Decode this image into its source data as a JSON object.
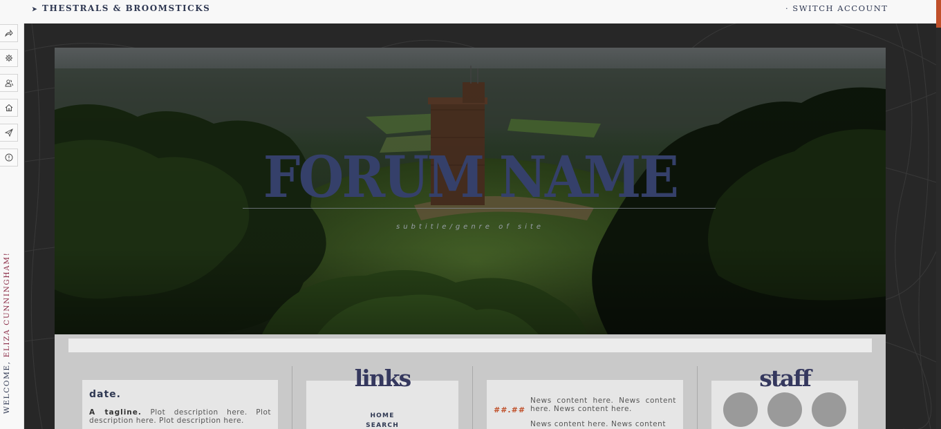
{
  "topbar": {
    "site_name": "THESTRALS & BROOMSTICKS",
    "switch_account": "· SWITCH ACCOUNT"
  },
  "sidebar": {
    "buttons": [
      {
        "icon": "share-icon"
      },
      {
        "icon": "gear-icon"
      },
      {
        "icon": "users-icon"
      },
      {
        "icon": "home-icon"
      },
      {
        "icon": "send-icon"
      },
      {
        "icon": "info-icon"
      }
    ],
    "welcome_prefix": "WELCOME, ",
    "welcome_name": "ELIZA CUNNINGHAM!"
  },
  "header": {
    "title": "FORUM NAME",
    "subtitle": "subtitle/genre of site"
  },
  "date_card": {
    "title": "date.",
    "tagline": "A tagline.",
    "description": "Plot description here. Plot description here. Plot description here."
  },
  "links": {
    "heading": "links",
    "items": [
      "HOME",
      "SEARCH"
    ]
  },
  "news": {
    "date": "##.##",
    "content_1": "News content here. News content here. News content here.",
    "content_2": "News content here. News content"
  },
  "staff": {
    "heading": "staff",
    "avatars": 3
  },
  "colors": {
    "accent": "#c0502a",
    "navy": "#2f3852",
    "plum": "#8b2b46",
    "panel": "#c9c9c9",
    "background": "#272727"
  }
}
